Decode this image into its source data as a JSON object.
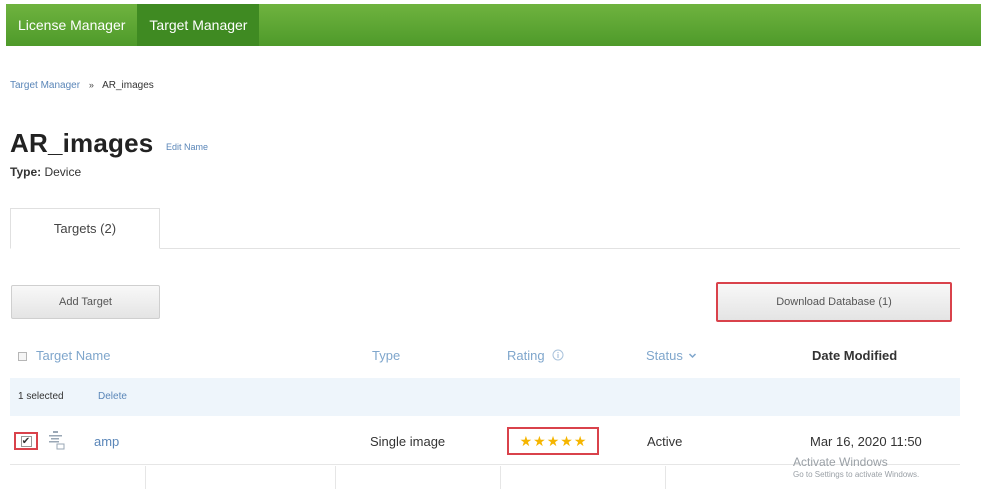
{
  "nav": {
    "license_manager": "License Manager",
    "target_manager": "Target Manager"
  },
  "breadcrumb": {
    "link": "Target Manager",
    "separator": "»",
    "current": "AR_images"
  },
  "database": {
    "name": "AR_images",
    "edit_name": "Edit Name",
    "type_key": "Type:",
    "type_value": "Device"
  },
  "tabs": {
    "targets": "Targets (2)"
  },
  "buttons": {
    "add_target": "Add Target",
    "download_database": "Download Database (1)"
  },
  "table": {
    "headers": {
      "target_name": "Target Name",
      "type": "Type",
      "rating": "Rating",
      "rating_info_icon": "info-icon",
      "status": "Status",
      "status_icon": "chevron-down-icon",
      "date_modified": "Date Modified"
    },
    "selection": {
      "count": "1 selected",
      "delete": "Delete"
    },
    "rows": [
      {
        "checked": true,
        "icon": "image-target-icon",
        "name": "amp",
        "type": "Single image",
        "rating": 5,
        "status": "Active",
        "date_modified": "Mar 16, 2020 11:50"
      }
    ]
  },
  "colors": {
    "nav_green": "#5aa532",
    "highlight_red": "#d9424b",
    "link_blue": "#5a86b8",
    "star": "#f5b500"
  },
  "watermark": {
    "title": "Activate Windows",
    "subtitle": "Go to Settings to activate Windows."
  }
}
